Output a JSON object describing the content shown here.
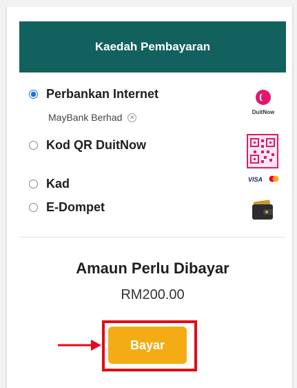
{
  "header": {
    "title": "Kaedah Pembayaran"
  },
  "payment_options": [
    {
      "label": "Perbankan Internet",
      "selected": true,
      "logo": "duitnow-logo",
      "logo_text": "DuitNow"
    },
    {
      "label": "Kod QR DuitNow",
      "selected": false,
      "logo": "qr-code-icon"
    },
    {
      "label": "Kad",
      "selected": false,
      "logo": "visa-mastercard-logo",
      "logo_text": "VISA"
    },
    {
      "label": "E-Dompet",
      "selected": false,
      "logo": "wallet-icon"
    }
  ],
  "selected_bank": {
    "name": "MayBank Berhad"
  },
  "amount": {
    "label": "Amaun Perlu Dibayar",
    "value": "RM200.00"
  },
  "pay_button": {
    "label": "Bayar"
  },
  "colors": {
    "header_bg": "#13615e",
    "button_bg": "#f4ac16",
    "highlight": "#e30b17",
    "radio_selected": "#1a73e8",
    "duitnow": "#e0196e"
  }
}
